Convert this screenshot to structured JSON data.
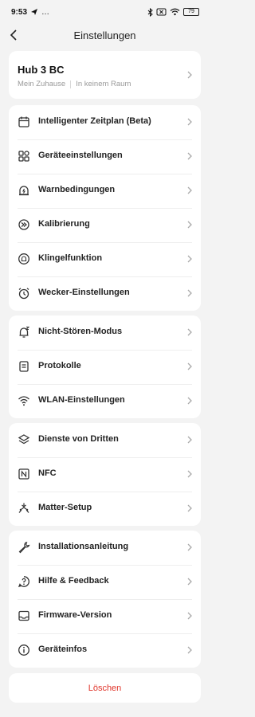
{
  "status_bar": {
    "time": "9:53",
    "extra": "…",
    "battery": "79"
  },
  "nav": {
    "title": "Einstellungen"
  },
  "hub": {
    "name": "Hub 3 BC",
    "home": "Mein Zuhause",
    "room": "In keinem Raum"
  },
  "groups": [
    {
      "items": [
        {
          "label": "Intelligenter Zeitplan (Beta)",
          "icon": "calendar-icon"
        },
        {
          "label": "Geräteeinstellungen",
          "icon": "grid-icon"
        },
        {
          "label": "Warnbedingungen",
          "icon": "alert-icon"
        },
        {
          "label": "Kalibrierung",
          "icon": "calibration-icon"
        },
        {
          "label": "Klingelfunktion",
          "icon": "bell-circle-icon"
        },
        {
          "label": "Wecker-Einstellungen",
          "icon": "alarm-clock-icon"
        }
      ]
    },
    {
      "items": [
        {
          "label": "Nicht-Stören-Modus",
          "icon": "bell-off-icon"
        },
        {
          "label": "Protokolle",
          "icon": "document-icon"
        },
        {
          "label": "WLAN-Einstellungen",
          "icon": "wifi-icon"
        }
      ]
    },
    {
      "items": [
        {
          "label": "Dienste von Dritten",
          "icon": "layers-icon"
        },
        {
          "label": "NFC",
          "icon": "nfc-icon"
        },
        {
          "label": "Matter-Setup",
          "icon": "matter-icon"
        }
      ]
    },
    {
      "items": [
        {
          "label": "Installationsanleitung",
          "icon": "wrench-icon"
        },
        {
          "label": "Hilfe & Feedback",
          "icon": "help-icon"
        },
        {
          "label": "Firmware-Version",
          "icon": "firmware-icon"
        },
        {
          "label": "Geräteinfos",
          "icon": "info-icon"
        }
      ]
    }
  ],
  "delete": {
    "label": "Löschen",
    "color": "#e0352b"
  }
}
